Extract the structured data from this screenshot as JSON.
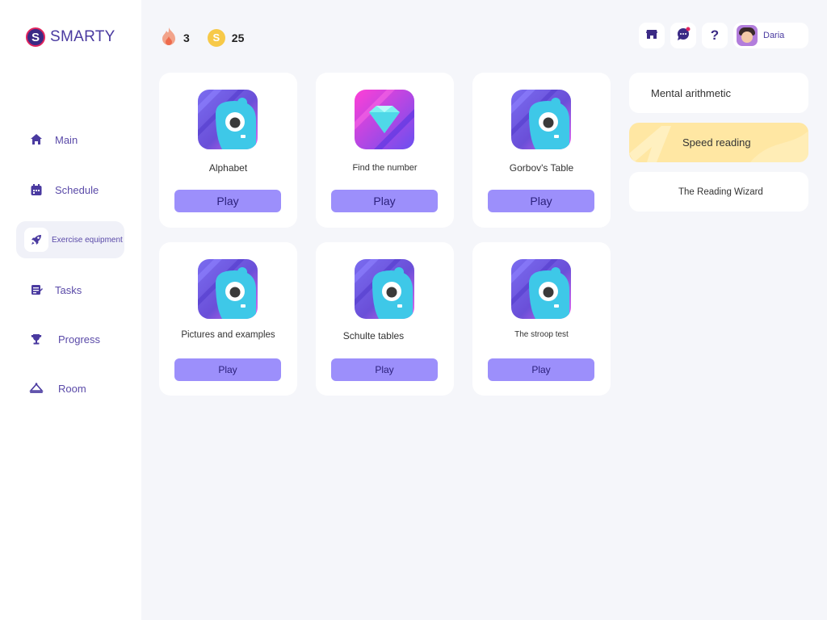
{
  "brand": {
    "logo_letter": "S",
    "name": "SMARTY",
    "accent": "#e0245e",
    "primary": "#3b2a85"
  },
  "nav": {
    "items": [
      {
        "label": "Main",
        "icon": "home-icon"
      },
      {
        "label": "Schedule",
        "icon": "calendar-icon"
      },
      {
        "label": "Exercise equipment",
        "icon": "rocket-icon",
        "active": true
      },
      {
        "label": "Tasks",
        "icon": "tasks-icon"
      },
      {
        "label": "Progress",
        "icon": "trophy-icon"
      },
      {
        "label": "Room",
        "icon": "room-icon"
      }
    ]
  },
  "stats": {
    "streak": "3",
    "streak_icon": "flame-icon",
    "coins": "25",
    "coin_symbol": "S",
    "coin_color": "#f7c948"
  },
  "topbar": {
    "shop_icon": "shop-icon",
    "chat_icon": "chat-icon",
    "help_symbol": "?",
    "user_name": "Daria"
  },
  "games": [
    {
      "title": "Alphabet",
      "play": "Play",
      "tile": "monster"
    },
    {
      "title": "Find the number",
      "play": "Play",
      "tile": "gem"
    },
    {
      "title": "Gorbov's Table",
      "play": "Play",
      "tile": "monster"
    },
    {
      "title": "Pictures and examples",
      "play": "Play",
      "tile": "monster"
    },
    {
      "title": "Schulte tables",
      "play": "Play",
      "tile": "monster"
    },
    {
      "title": "The stroop test",
      "play": "Play",
      "tile": "monster"
    }
  ],
  "categories": [
    {
      "label": "Mental arithmetic"
    },
    {
      "label": "Speed reading",
      "active": true
    },
    {
      "label": "The Reading Wizard"
    }
  ]
}
